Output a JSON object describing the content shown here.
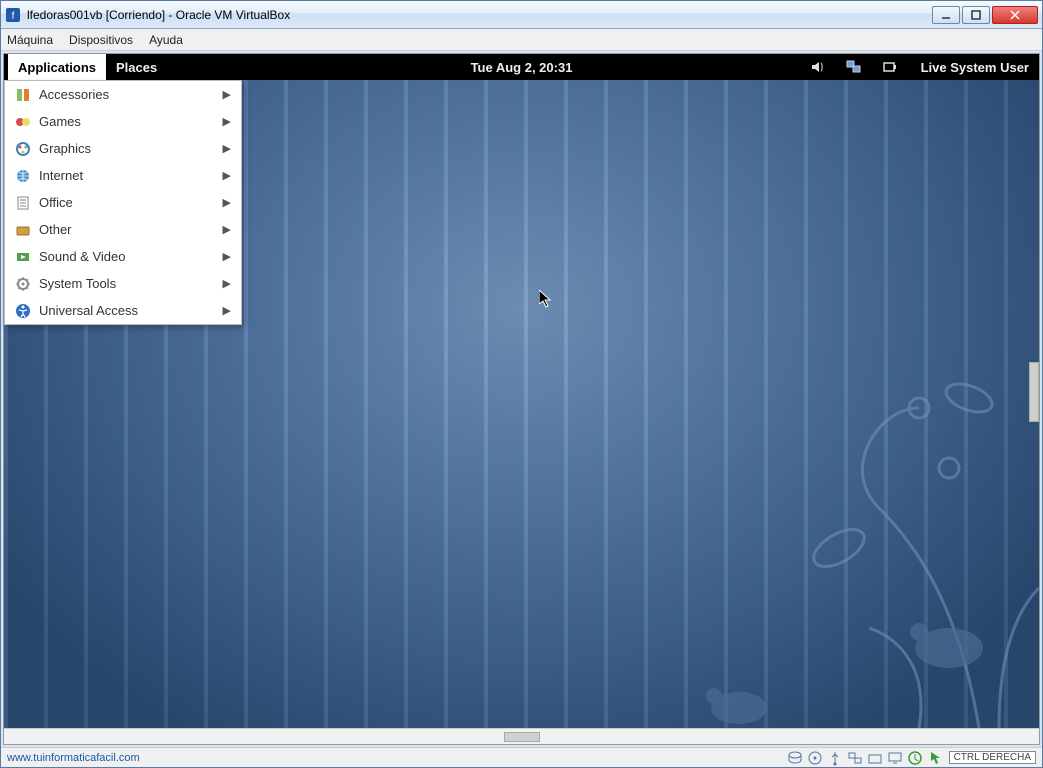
{
  "window_title": "lfedoras001vb [Corriendo] - Oracle VM VirtualBox",
  "vbox_menu": {
    "machine": "Máquina",
    "devices": "Dispositivos",
    "help": "Ayuda"
  },
  "gnome": {
    "applications": "Applications",
    "places": "Places",
    "clock": "Tue Aug  2, 20:31",
    "user": "Live System User"
  },
  "apps_menu": [
    {
      "label": "Accessories",
      "icon": "accessories"
    },
    {
      "label": "Games",
      "icon": "games"
    },
    {
      "label": "Graphics",
      "icon": "graphics"
    },
    {
      "label": "Internet",
      "icon": "internet"
    },
    {
      "label": "Office",
      "icon": "office"
    },
    {
      "label": "Other",
      "icon": "other"
    },
    {
      "label": "Sound & Video",
      "icon": "media"
    },
    {
      "label": "System Tools",
      "icon": "systools"
    },
    {
      "label": "Universal Access",
      "icon": "accessibility"
    }
  ],
  "statusbar": {
    "link": "www.tuinformaticafacil.com",
    "hostkey": "CTRL DERECHA"
  }
}
